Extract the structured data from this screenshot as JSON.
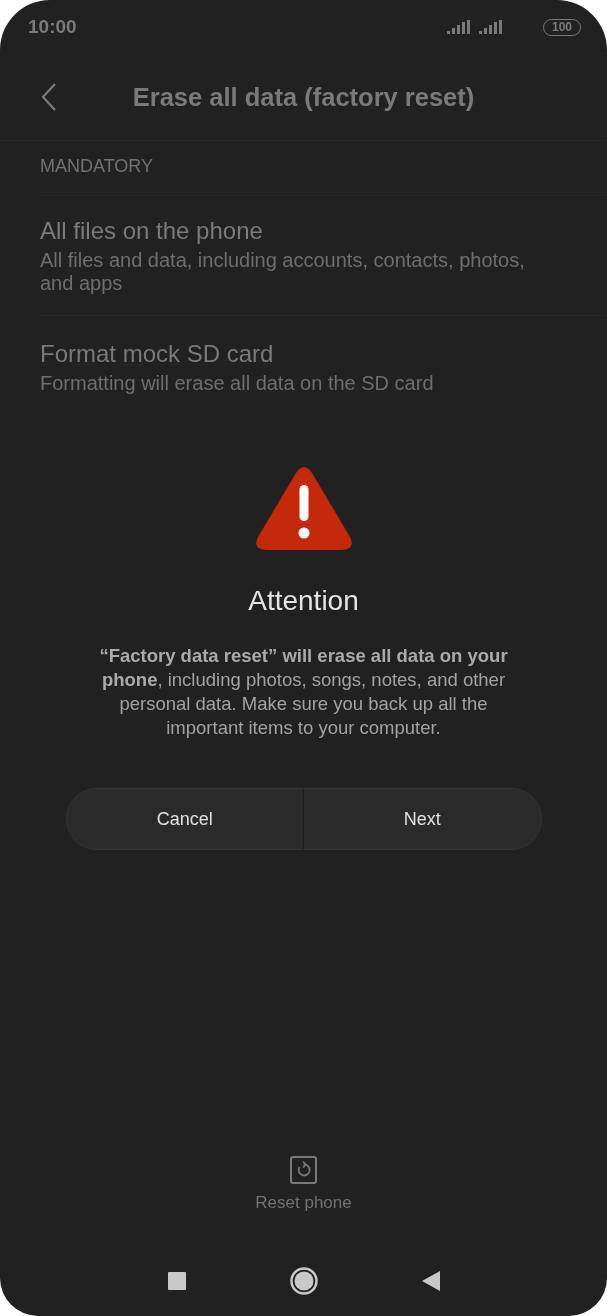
{
  "status_bar": {
    "time": "10:00",
    "battery": "100"
  },
  "header": {
    "title": "Erase all data (factory reset)"
  },
  "section": {
    "label": "MANDATORY",
    "items": [
      {
        "title": "All files on the phone",
        "subtitle": "All files and data, including accounts, contacts, photos, and apps"
      },
      {
        "title": "Format mock SD card",
        "subtitle": "Formatting will erase all data on the SD card"
      }
    ]
  },
  "dialog": {
    "title": "Attention",
    "message": "**“Factory data reset” will erase all data on your phone**, including photos, songs, notes, and other personal data. Make sure you back up all the important items to your computer.",
    "buttons": [
      {
        "label": "Cancel"
      },
      {
        "label": "Next"
      }
    ]
  },
  "footer": {
    "label": "Reset phone"
  }
}
